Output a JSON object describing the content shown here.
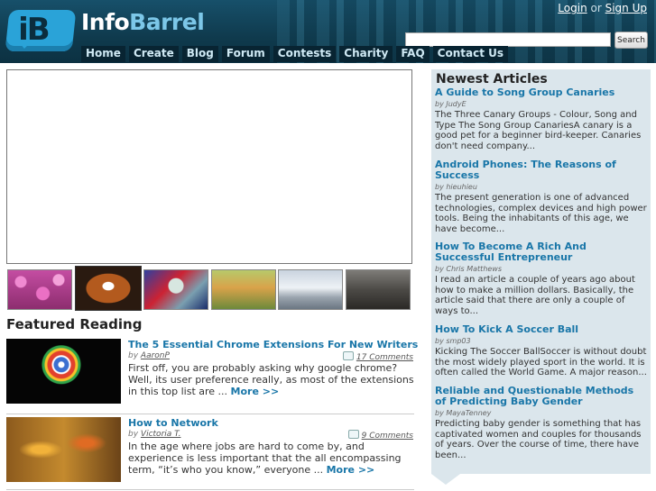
{
  "header": {
    "logo_mark": "iB",
    "logo_text_1": "Info",
    "logo_text_2": "Barrel",
    "login": "Login",
    "or": "or",
    "signup": "Sign Up",
    "search_button": "Search",
    "nav": [
      "Home",
      "Create",
      "Blog",
      "Forum",
      "Contests",
      "Charity",
      "FAQ",
      "Contact Us"
    ]
  },
  "featured": {
    "heading": "Featured Reading",
    "articles": [
      {
        "title": "The 5 Essential Chrome Extensions For New Writers",
        "by": "by",
        "author": "AaronP",
        "comments": "17 Comments",
        "body": "First off, you are probably asking why google chrome? Well, its user preference really,  as most of the extensions in this top list are ...",
        "more": "More >>"
      },
      {
        "title": "How to Network",
        "by": "by",
        "author": "Victoria T.",
        "comments": "9 Comments",
        "body": "In the age where jobs are hard to come by, and experience is less important that the all encompassing term, “it’s who you know,” everyone ...",
        "more": "More >>"
      }
    ]
  },
  "newest": {
    "heading": "Newest Articles",
    "articles": [
      {
        "title": "A Guide to Song Group Canaries",
        "author": "by JudyE",
        "desc": "The Three Canary Groups - Colour, Song and Type The Song Group CanariesA canary is a good pet for a beginner bird-keeper. Canaries don't need company..."
      },
      {
        "title": "Android Phones: The Reasons of Success",
        "author": "by hieuhieu",
        "desc": "The present generation is one of advanced technologies, complex devices and high power tools. Being the inhabitants of this age, we have become..."
      },
      {
        "title": "How To Become A Rich And Successful Entrepreneur",
        "author": "by Chris Matthews",
        "desc": "I read an article a couple of years ago about how to make a million dollars. Basically, the article said that there are only a couple of ways to..."
      },
      {
        "title": "How To Kick A Soccer Ball",
        "author": "by smp03",
        "desc": "Kicking The Soccer BallSoccer is without doubt the most widely played sport in the world.  It is often called the World Game. A major reason..."
      },
      {
        "title": "Reliable and Questionable Methods of Predicting Baby Gender",
        "author": "by MayaTenney",
        "desc": "Predicting baby gender is something that has captivated women and couples for thousands of years.  Over the course of time, there have been..."
      }
    ]
  }
}
